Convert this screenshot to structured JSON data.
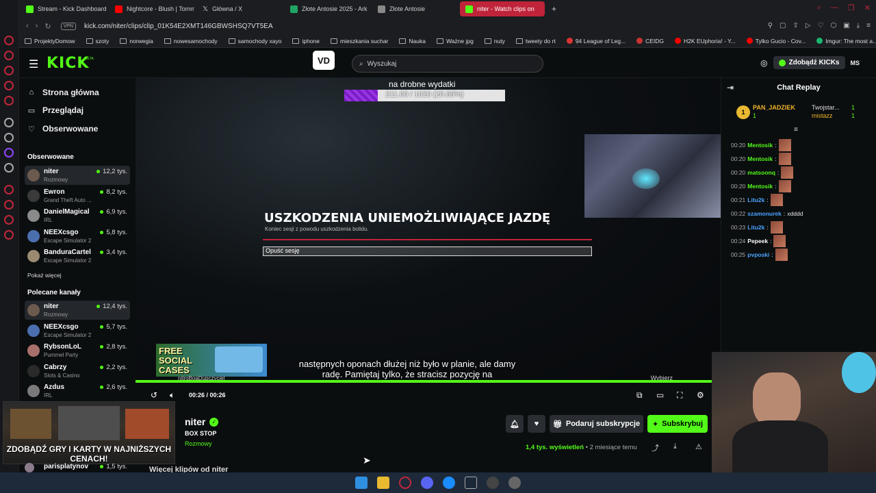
{
  "browser": {
    "tabs": [
      {
        "label": "Stream - Kick Dashboard",
        "color": "#53fc18"
      },
      {
        "label": "Nightcore - Blush | Tomm",
        "color": "#ff0000"
      },
      {
        "label": "Główna / X",
        "color": "#ffffff"
      },
      {
        "label": "Złote Antosie 2025 - Ark",
        "color": "#1fa463"
      },
      {
        "label": "Złote Antosie",
        "color": "#cccccc"
      },
      {
        "label": "niter - Watch clips on",
        "color": "#53fc18"
      }
    ],
    "url": "kick.com/niter/clips/clip_01K54E2XMT146GBWSHSQ7VT5EA",
    "vpn_label": "VPN",
    "bookmarks": [
      "ProjektyDomow",
      "szoty",
      "norwegia",
      "nowesamochody",
      "samochody xayo",
      "iphone",
      "mieszkania suchar",
      "Nauka",
      "Ważne jpg",
      "nuty",
      "tweety do rt",
      "94 League of Leg...",
      "CEIDG",
      "H2K EUphoria! - Y...",
      "Tylko Gucio - Cov...",
      "Imgur: The most a..."
    ]
  },
  "header": {
    "logo": "KICK",
    "beta": "BETA",
    "vd_logo": "VD",
    "search_placeholder": "Wyszukaj",
    "get_kicks": "Zdobądź KICKs",
    "user_initials": "MS"
  },
  "sidebar": {
    "nav": [
      {
        "label": "Strona główna",
        "icon": "home-icon"
      },
      {
        "label": "Przeglądaj",
        "icon": "browse-icon"
      },
      {
        "label": "Obserwowane",
        "icon": "heart-icon"
      }
    ],
    "followed_title": "Obserwowane",
    "followed": [
      {
        "name": "niter",
        "category": "Rozmowy",
        "viewers": "12,2 tys.",
        "color": "#6b5a4e"
      },
      {
        "name": "Ewron",
        "category": "Grand Theft Auto ...",
        "viewers": "8,2 tys.",
        "color": "#3a3a3a"
      },
      {
        "name": "DanielMagical",
        "category": "IRL",
        "viewers": "6,9 tys.",
        "color": "#8a8a8a"
      },
      {
        "name": "NEEXcsgo",
        "category": "Escape Simulator 2",
        "viewers": "5,8 tys.",
        "color": "#4b6fae"
      },
      {
        "name": "BanduraCartel",
        "category": "Escape Simulator 2",
        "viewers": "3,4 tys.",
        "color": "#9a8a70"
      }
    ],
    "show_more": "Pokaż więcej",
    "recommended_title": "Polecane kanały",
    "recommended": [
      {
        "name": "niter",
        "category": "Rozmowy",
        "viewers": "12,4 tys.",
        "color": "#6b5a4e"
      },
      {
        "name": "NEEXcsgo",
        "category": "Escape Simulator 2",
        "viewers": "5,7 tys.",
        "color": "#4b6fae"
      },
      {
        "name": "RybsonLoL",
        "category": "Pummel Party",
        "viewers": "2,8 tys.",
        "color": "#a8706a"
      },
      {
        "name": "Cabrzy",
        "category": "Slots & Casino",
        "viewers": "2,2 tys.",
        "color": "#2a2a2a"
      },
      {
        "name": "Azdus",
        "category": "IRL",
        "viewers": "2,6 tys.",
        "color": "#7a7a7a"
      }
    ],
    "partial_channel": {
      "name": "parisplatynov",
      "viewers": "1,5 tys."
    }
  },
  "video": {
    "goal_text": "na drobne wydatki",
    "goal_label": "211.00 / 1020 (20.69%)",
    "goal_fraction": 0.2069,
    "game_title": "USZKODZENIA UNIEMOŻLIWIAJĄCE JAZDĘ",
    "game_subtitle": "Koniec sesji z powodu uszkodzenia bolidu.",
    "leave_button": "Opuść sesję",
    "promo_text": "FREE SOCIAL CASES",
    "promo_sub": "nitroBoaDupczyciel",
    "subtitles": "następnych oponach dłużej niż było w planie, ale damy radę. Pamiętaj tylko, że stracisz pozycję na",
    "choose": "Wybierz",
    "time": "00:26 / 00:26",
    "progress": 1.0
  },
  "clip": {
    "streamer": "niter",
    "title": "BOX STOP",
    "category": "Rozmowy",
    "gift_sub": "Podaruj subskrypcje",
    "subscribe": "Subskrybuj",
    "views": "1,4 tys. wyświetleń",
    "ago": "• 2 miesiące temu",
    "more_clips": "Więcej klipów od niter"
  },
  "ad": {
    "text": "ZDOBĄDŹ GRY I KARTY W NAJNIŻSZYCH CENACH!"
  },
  "chat": {
    "title": "Chat Replay",
    "top_gifter": {
      "rank": "1",
      "name": "PAN_JADZIEK",
      "count": "1"
    },
    "gifters": [
      {
        "name": "Twojstar...",
        "count": "1"
      },
      {
        "name": "mistazz",
        "count": "1"
      }
    ],
    "messages": [
      {
        "time": "00:20",
        "user": "Mentosik",
        "color": "#53fc18",
        "text": ""
      },
      {
        "time": "00:20",
        "user": "Mentosik",
        "color": "#53fc18",
        "text": ""
      },
      {
        "time": "00:20",
        "user": "matsoonq",
        "color": "#53fc18",
        "text": ""
      },
      {
        "time": "00:20",
        "user": "Mentosik",
        "color": "#53fc18",
        "text": ""
      },
      {
        "time": "00:21",
        "user": "Litu2k",
        "color": "#4aa3ff",
        "text": ""
      },
      {
        "time": "00:22",
        "user": "szamonurek",
        "color": "#4aa3ff",
        "text": " xdddd"
      },
      {
        "time": "00:23",
        "user": "Litu2k",
        "color": "#4aa3ff",
        "text": ""
      },
      {
        "time": "00:24",
        "user": "Pepeek",
        "color": "#ffffff",
        "text": ""
      },
      {
        "time": "00:25",
        "user": "pvposki",
        "color": "#4aa3ff",
        "text": ""
      }
    ]
  }
}
